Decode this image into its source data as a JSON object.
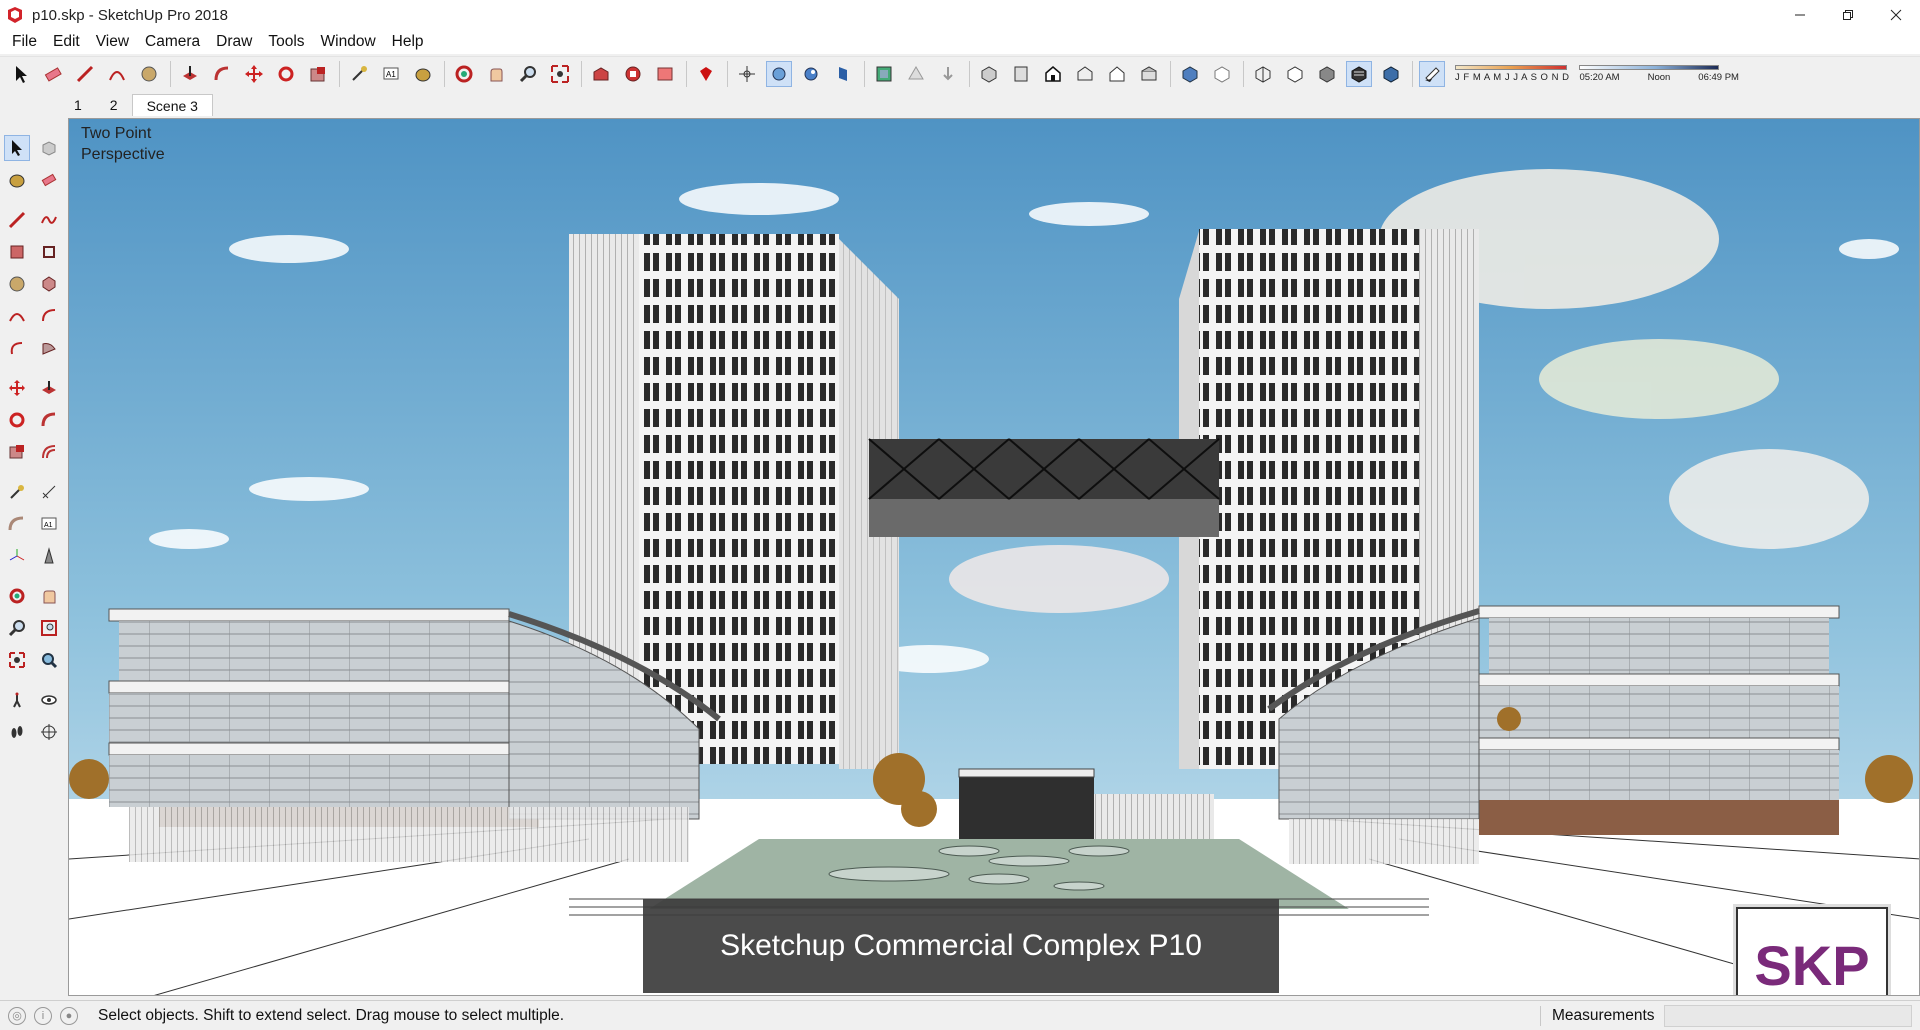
{
  "window": {
    "title": "p10.skp - SketchUp Pro 2018",
    "controls": [
      "minimize",
      "restore",
      "close"
    ]
  },
  "menu": [
    "File",
    "Edit",
    "View",
    "Camera",
    "Draw",
    "Tools",
    "Window",
    "Help"
  ],
  "toolbar": {
    "icons": [
      "select-icon",
      "eraser-icon",
      "pencil-icon",
      "arc-icon",
      "shape-icon",
      "pushpull-icon",
      "followme-icon",
      "move-icon",
      "rotate-icon",
      "scale-icon",
      "tape-icon",
      "text-icon",
      "paint-icon",
      "orbit-icon",
      "pan-icon",
      "zoom-icon",
      "zoom-extents-icon",
      "warehouse-icon",
      "extension-warehouse-icon",
      "layout-icon",
      "ruby-icon",
      "position-camera-icon",
      "walk-icon",
      "look-around-icon",
      "section-icon",
      "section-display-icon",
      "section-cut-icon",
      "iso-view-icon",
      "top-view-icon",
      "front-view-icon",
      "right-view-icon",
      "back-view-icon",
      "left-view-icon",
      "xray-icon",
      "back-edges-icon",
      "wireframe-icon",
      "hidden-line-icon",
      "shaded-icon",
      "textured-icon",
      "monochrome-icon",
      "shadows-toggle-icon"
    ],
    "shadow_months": "J F M A M J J A S O N D",
    "shadow_times": [
      "05:20 AM",
      "Noon",
      "06:49 PM"
    ]
  },
  "scenes": {
    "tabs": [
      "1",
      "2",
      "Scene 3"
    ],
    "active": "Scene 3"
  },
  "viewport": {
    "camera_label_line1": "Two Point",
    "camera_label_line2": "Perspective",
    "caption": "Sketchup Commercial Complex P10",
    "badge": "SKP"
  },
  "status": {
    "hint": "Select objects. Shift to extend select. Drag mouse to select multiple.",
    "measurements_label": "Measurements"
  },
  "colors": {
    "sky_top": "#4f93c4",
    "sky_bottom": "#cfe6f1",
    "badge_text": "#7a2a7a"
  }
}
